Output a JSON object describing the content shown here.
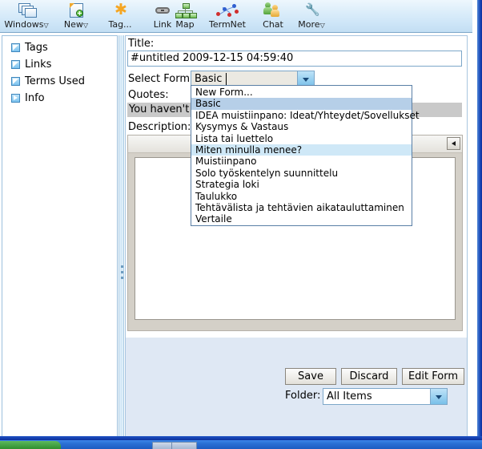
{
  "toolbar": {
    "items": [
      {
        "label": "Windows",
        "icon": "windows-icon",
        "caret": "▽"
      },
      {
        "label": "New",
        "icon": "new-note-icon",
        "caret": "▽"
      },
      {
        "label": "Tag...",
        "icon": "tag-star-icon",
        "caret": ""
      },
      {
        "label": "Link",
        "icon": "link-chain-icon",
        "caret": ""
      },
      {
        "label": "Map",
        "icon": "map-tree-icon",
        "caret": ""
      },
      {
        "label": "TermNet",
        "icon": "termnet-graph-icon",
        "caret": ""
      },
      {
        "label": "Chat",
        "icon": "chat-people-icon",
        "caret": ""
      },
      {
        "label": "More",
        "icon": "more-wrench-icon",
        "caret": "▽"
      }
    ]
  },
  "sidebar": {
    "items": [
      {
        "label": "Tags",
        "state": "expanded",
        "icon": "tree-expanded-icon"
      },
      {
        "label": "Links",
        "state": "expanded",
        "icon": "tree-expanded-icon"
      },
      {
        "label": "Terms Used",
        "state": "expanded",
        "icon": "tree-expanded-icon"
      },
      {
        "label": "Info",
        "state": "collapsed",
        "icon": "tree-collapsed-icon"
      }
    ]
  },
  "form": {
    "title_label": "Title:",
    "title_value": "#untitled 2009-12-15 04:59:40",
    "select_form_label": "Select Form:",
    "select_form_value": "Basic",
    "quotes_label": "Quotes:",
    "quotes_value": "You haven't l",
    "description_label": "Description:",
    "description_value": ""
  },
  "dropdown": {
    "options": [
      "New Form...",
      "Basic",
      "IDEA muistiinpano: Ideat/Yhteydet/Sovellukset",
      "Kysymys & Vastaus",
      "Lista tai luettelo",
      "Miten minulla menee?",
      "Muistiinpano",
      "Solo työskentelyn suunnittelu",
      "Strategia loki",
      "Taulukko",
      "Tehtävälista ja tehtävien aikatauluttaminen",
      "Vertaile"
    ],
    "selected_index": 1,
    "hovered_index": 5
  },
  "actions": {
    "save_label": "Save",
    "discard_label": "Discard",
    "edit_form_label": "Edit Form",
    "folder_label": "Folder:",
    "folder_value": "All Items"
  },
  "colors": {
    "toolbar_top": "#eef7fd",
    "toolbar_bottom": "#c2def3",
    "selection": "#b6cfe8",
    "hover": "#cfe8f7",
    "window_border": "#0c2f9c",
    "panel_bg": "#dfe8f4"
  }
}
